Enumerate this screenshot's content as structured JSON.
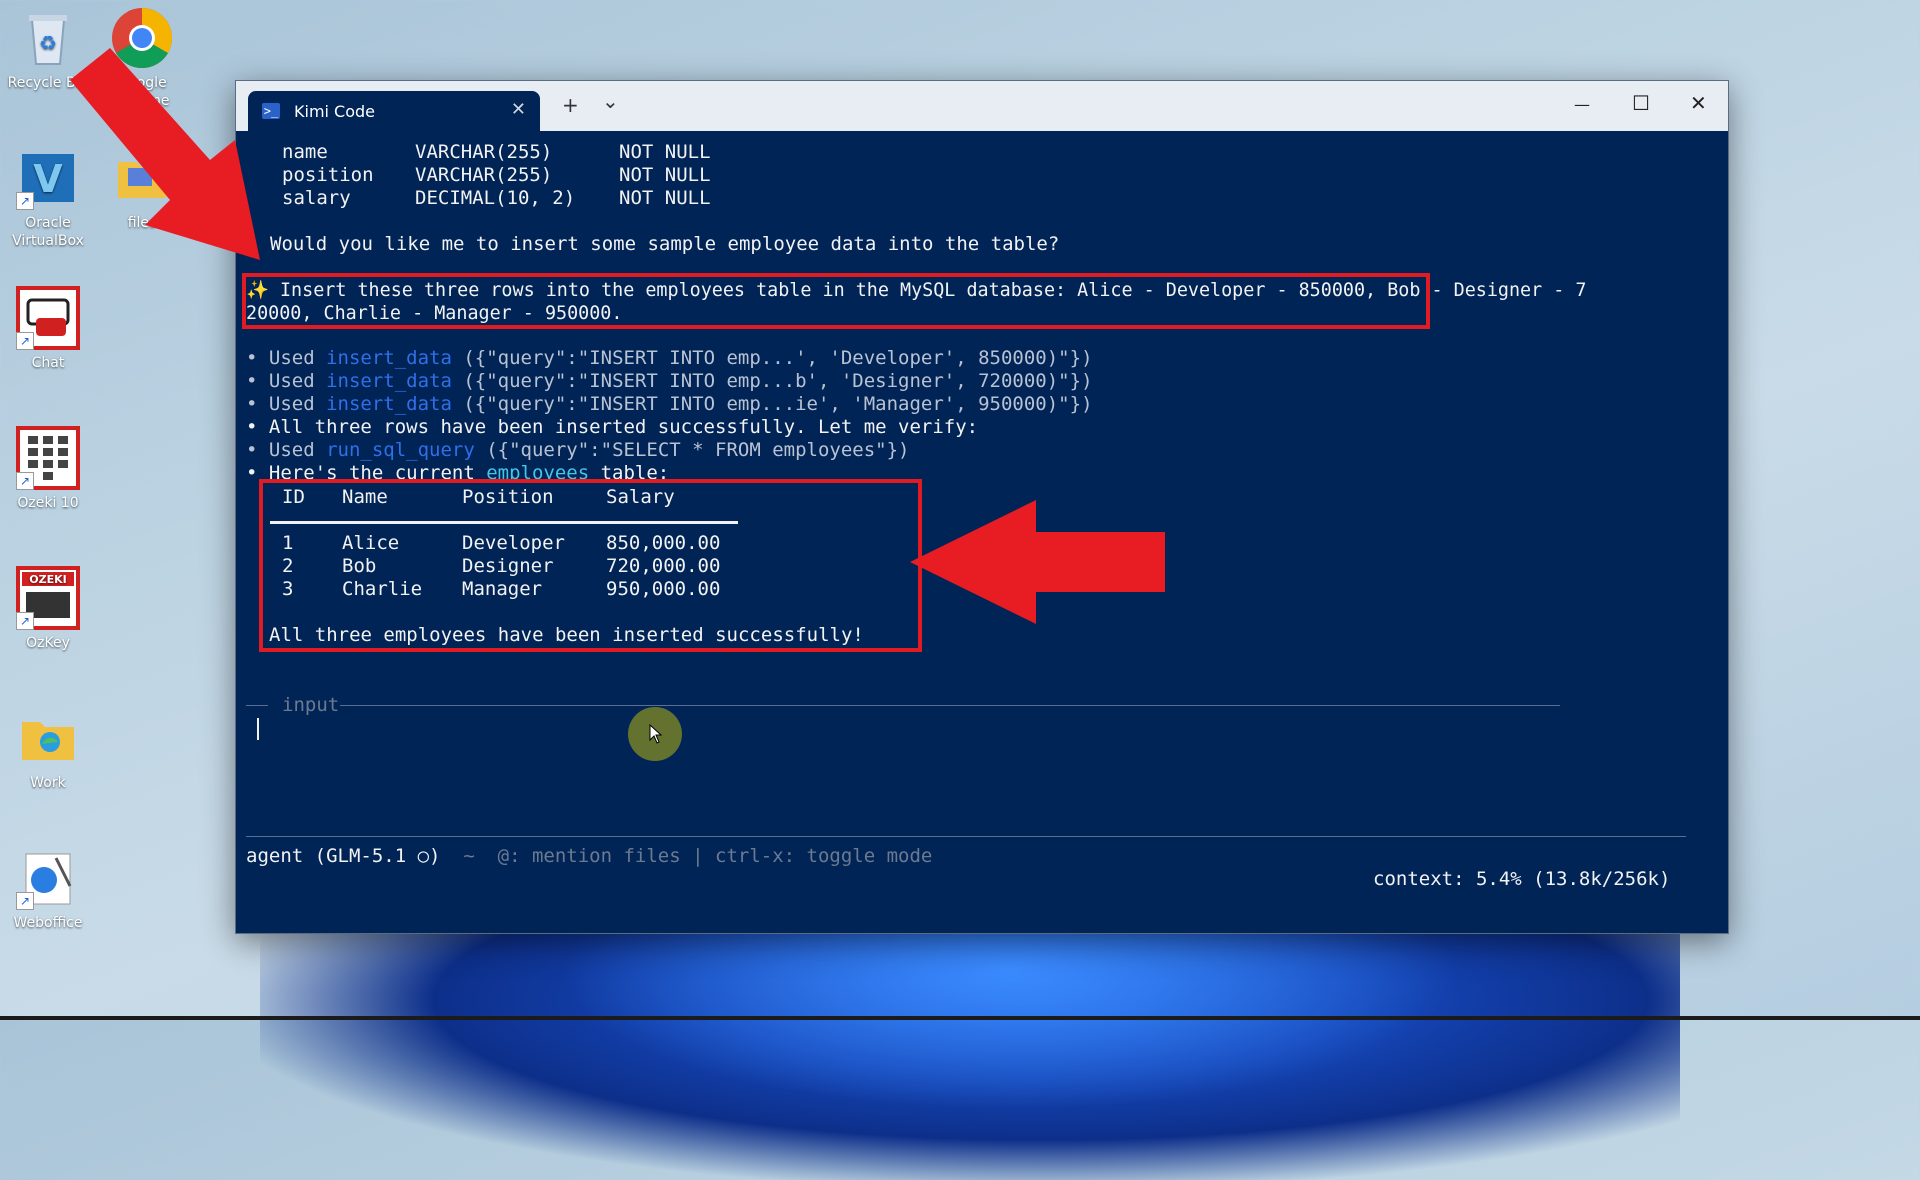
{
  "desktop": {
    "icons": [
      {
        "label": "Recycle Bin",
        "icon": "recycle-bin-icon"
      },
      {
        "label": "Google Chrome",
        "icon": "chrome-icon"
      },
      {
        "label": "Oracle VirtualBox",
        "icon": "virtualbox-icon"
      },
      {
        "label": "files",
        "icon": "folder-icon"
      },
      {
        "label": "Chat",
        "icon": "chat-icon"
      },
      {
        "label": "Ozeki 10",
        "icon": "ozeki-icon"
      },
      {
        "label": "OzKey",
        "icon": "ozkey-icon"
      },
      {
        "label": "Work",
        "icon": "folder-icon"
      },
      {
        "label": "Weboffice",
        "icon": "weboffice-icon"
      }
    ]
  },
  "window": {
    "tab_title": "Kimi Code",
    "tab_close": "✕",
    "new_tab": "+",
    "dropdown": "⌄",
    "minimize": "—",
    "maximize": "☐",
    "close": "✕"
  },
  "terminal": {
    "schema_rows": [
      {
        "col": "name",
        "type": "VARCHAR(255)",
        "null": "NOT NULL"
      },
      {
        "col": "position",
        "type": "VARCHAR(255)",
        "null": "NOT NULL"
      },
      {
        "col": "salary",
        "type": "DECIMAL(10, 2)",
        "null": "NOT NULL"
      }
    ],
    "question": "Would you like me to insert some sample employee data into the table?",
    "prompt_icon": "✨",
    "prompt_line1": " Insert these three rows into the employees table in the MySQL database: Alice - Developer - 850000, Bob - Designer - 7",
    "prompt_line2": "20000, Charlie - Manager - 950000.",
    "tool_calls": [
      {
        "prefix": "• Used ",
        "tool": "insert_data",
        "args": " ({\"query\":\"INSERT INTO emp...', 'Developer', 850000)\"})"
      },
      {
        "prefix": "• Used ",
        "tool": "insert_data",
        "args": " ({\"query\":\"INSERT INTO emp...b', 'Designer', 720000)\"})"
      },
      {
        "prefix": "• Used ",
        "tool": "insert_data",
        "args": " ({\"query\":\"INSERT INTO emp...ie', 'Manager', 950000)\"})"
      }
    ],
    "verify_line": "• All three rows have been inserted successfully. Let me verify:",
    "select_call": {
      "prefix": "• Used ",
      "tool": "run_sql_query",
      "args": " ({\"query\":\"SELECT * FROM employees\"})"
    },
    "current_table_pre": "• Here's the current ",
    "current_table_hl": "employees",
    "current_table_post": " table:",
    "table": {
      "headers": [
        "ID",
        "Name",
        "Position",
        "Salary"
      ],
      "rows": [
        [
          "1",
          "Alice",
          "Developer",
          "850,000.00"
        ],
        [
          "2",
          "Bob",
          "Designer",
          "720,000.00"
        ],
        [
          "3",
          "Charlie",
          "Manager",
          "950,000.00"
        ]
      ]
    },
    "success": "All three employees have been inserted successfully!",
    "input_label": "input",
    "status_mode": "agent (GLM-5.1 ○)",
    "status_hint": "  ~  @: mention files | ctrl-x: toggle mode",
    "context": "context: 5.4% (13.8k/256k)"
  }
}
